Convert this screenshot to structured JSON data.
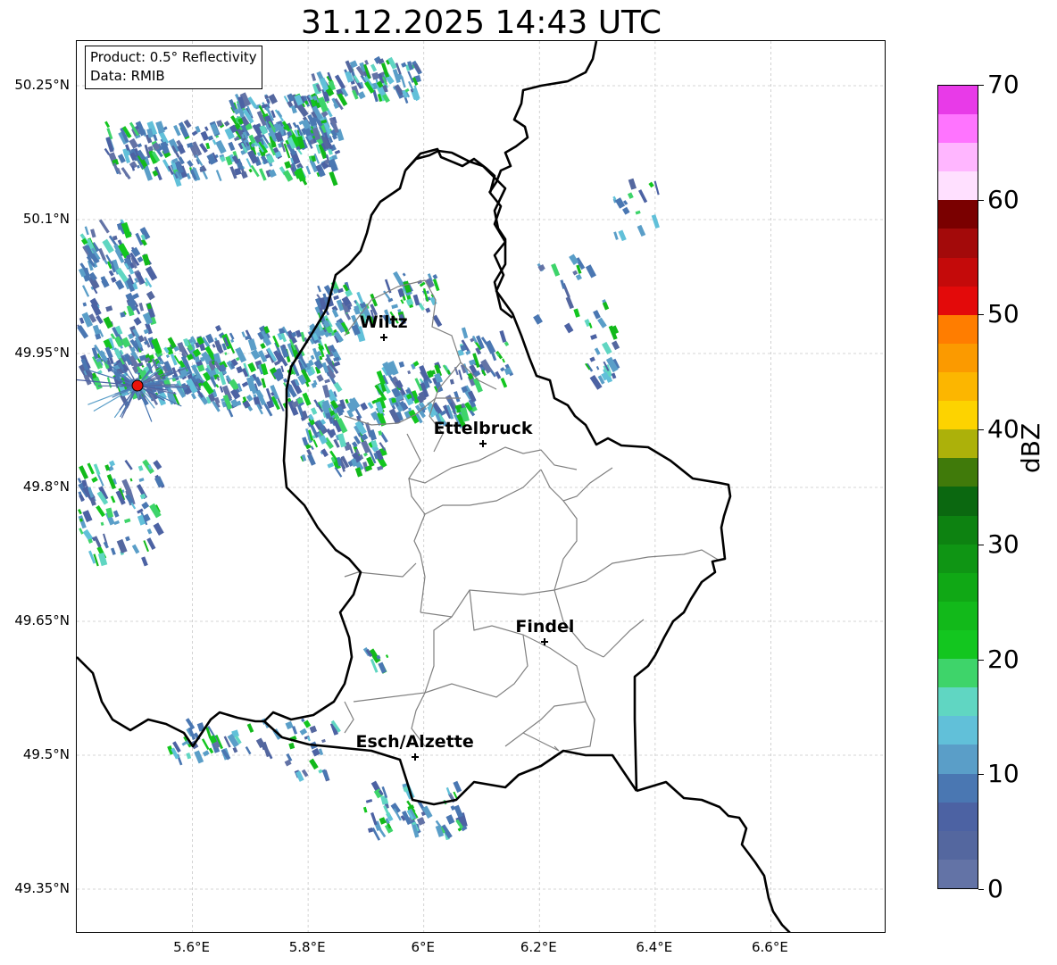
{
  "title": "31.12.2025 14:43 UTC",
  "info": {
    "product": "Product: 0.5° Reflectivity",
    "source": "Data: RMIB"
  },
  "axes": {
    "lat_ticks": [
      "50.25°N",
      "50.1°N",
      "49.95°N",
      "49.8°N",
      "49.65°N",
      "49.5°N",
      "49.35°N"
    ],
    "lon_ticks": [
      "5.6°E",
      "5.8°E",
      "6°E",
      "6.2°E",
      "6.4°E",
      "6.6°E"
    ],
    "lat_range": [
      49.3,
      50.3
    ],
    "lon_range": [
      5.4,
      6.8
    ]
  },
  "cities": [
    {
      "name": "Wiltz",
      "lat": 49.967,
      "lon": 5.932
    },
    {
      "name": "Ettelbruck",
      "lat": 49.848,
      "lon": 6.104
    },
    {
      "name": "Findel",
      "lat": 49.626,
      "lon": 6.211
    },
    {
      "name": "Esch/Alzette",
      "lat": 49.497,
      "lon": 5.986
    }
  ],
  "radar_site": {
    "lat": 49.914,
    "lon": 5.505,
    "color": "#e8140a"
  },
  "colorbar": {
    "label": "dBZ",
    "min": 0,
    "max": 70,
    "tick_labels": [
      "0",
      "10",
      "20",
      "30",
      "40",
      "50",
      "60",
      "70"
    ],
    "colors": [
      "#6373a6",
      "#54679f",
      "#4c62a3",
      "#4a77b2",
      "#5a9ec8",
      "#61c0d9",
      "#60d6c2",
      "#3ed46a",
      "#13c61f",
      "#12b91a",
      "#10a815",
      "#0f9514",
      "#0d8211",
      "#0b6810",
      "#407a0a",
      "#acb10a",
      "#fdd300",
      "#fcb600",
      "#fb9a00",
      "#ff7d00",
      "#e30a0a",
      "#c40a0a",
      "#a30a0a",
      "#7a0000",
      "#ffe0ff",
      "#ffb6ff",
      "#ff74ff",
      "#e83ae8"
    ]
  }
}
